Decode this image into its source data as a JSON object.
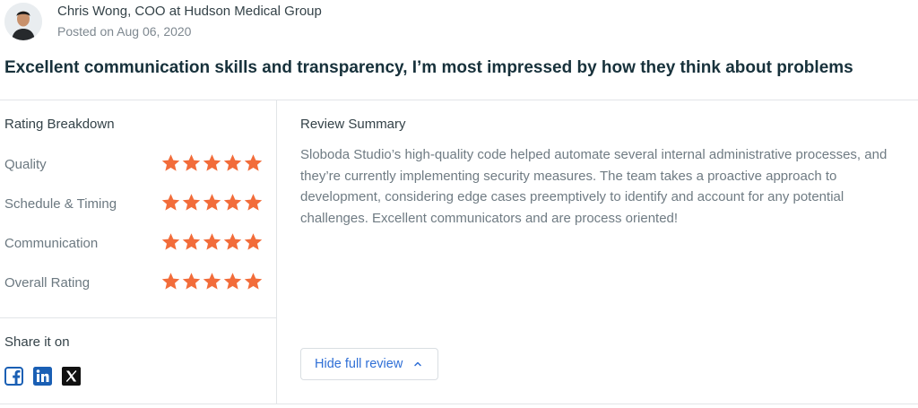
{
  "review": {
    "author": "Chris Wong, COO at Hudson Medical Group",
    "posted": "Posted on Aug 06, 2020",
    "headline": "Excellent communication skills and transparency, I’m most impressed by how they think about problems"
  },
  "ratings": {
    "title": "Rating Breakdown",
    "items": [
      {
        "label": "Quality",
        "stars": 5
      },
      {
        "label": "Schedule & Timing",
        "stars": 5
      },
      {
        "label": "Communication",
        "stars": 5
      },
      {
        "label": "Overall Rating",
        "stars": 5
      }
    ],
    "star_color": "#f26c3a"
  },
  "share": {
    "title": "Share it on",
    "icons": [
      "facebook-icon",
      "linkedin-icon",
      "x-twitter-icon"
    ],
    "brand_color": "#1a5fb4"
  },
  "summary": {
    "title": "Review Summary",
    "text": "Sloboda Studio’s high-quality code helped automate several internal administrative processes, and they’re currently implementing security measures. The team takes a proactive approach to development, considering edge cases preemptively to identify and account for any potential challenges. Excellent communicators and are process oriented!"
  },
  "actions": {
    "hide_label": "Hide full review",
    "hide_icon": "chevron-up-icon"
  }
}
